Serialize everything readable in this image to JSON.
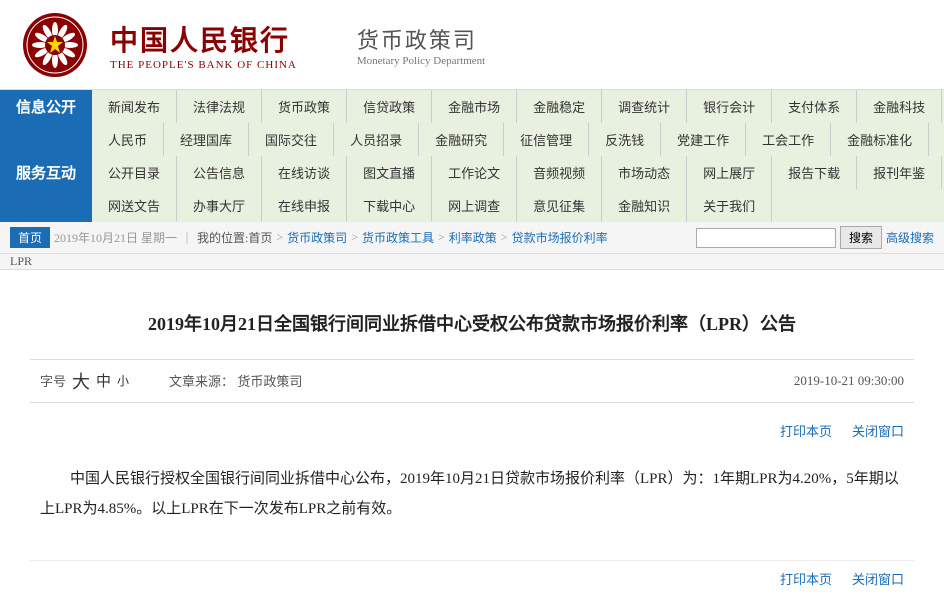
{
  "header": {
    "logo_chinese": "中国人民银行",
    "logo_english": "THE PEOPLE'S BANK OF CHINA",
    "dept_chinese": "货币政策司",
    "dept_english": "Monetary Policy Department"
  },
  "nav": {
    "section1_label": "信息公开",
    "section2_label": "服务互动",
    "row1": [
      "新闻发布",
      "法律法规",
      "货币政策",
      "信贷政策",
      "金融市场",
      "金融稳定",
      "调查统计",
      "银行会计",
      "支付体系",
      "金融科技"
    ],
    "row2": [
      "人民币",
      "经理国库",
      "国际交往",
      "人员招录",
      "金融研究",
      "征信管理",
      "反洗钱",
      "党建工作",
      "工会工作",
      "金融标准化"
    ],
    "row3": [
      "公开目录",
      "公告信息",
      "在线访谈",
      "图文直播",
      "工作论文",
      "音频视频",
      "市场动态",
      "网上展厅",
      "报告下载",
      "报刊年鉴"
    ],
    "row4": [
      "网送文告",
      "办事大厅",
      "在线申报",
      "下载中心",
      "网上调查",
      "意见征集",
      "金融知识",
      "关于我们"
    ]
  },
  "breadcrumb": {
    "home": "首页",
    "items": [
      "货币政策司",
      "货币政策工具",
      "利率政策",
      "贷款市场报价利率"
    ],
    "lpr_label": "LPR",
    "search_placeholder": "",
    "search_btn": "搜索",
    "advanced": "高级搜索"
  },
  "article": {
    "title": "2019年10月21日全国银行间同业拆借中心受权公布贷款市场报价利率（LPR）公告",
    "font_label": "字号",
    "font_large": "大",
    "font_medium": "中",
    "font_small": "小",
    "source_label": "文章来源：",
    "source": "货币政策司",
    "date": "2019-10-21 09:30:00",
    "print": "打印本页",
    "close": "关闭窗口",
    "body": "中国人民银行授权全国银行间同业拆借中心公布，2019年10月21日贷款市场报价利率（LPR）为：1年期LPR为4.20%，5年期以上LPR为4.85%。以上LPR在下一次发布LPR之前有效。",
    "print2": "打印本页",
    "close2": "关闭窗口"
  }
}
